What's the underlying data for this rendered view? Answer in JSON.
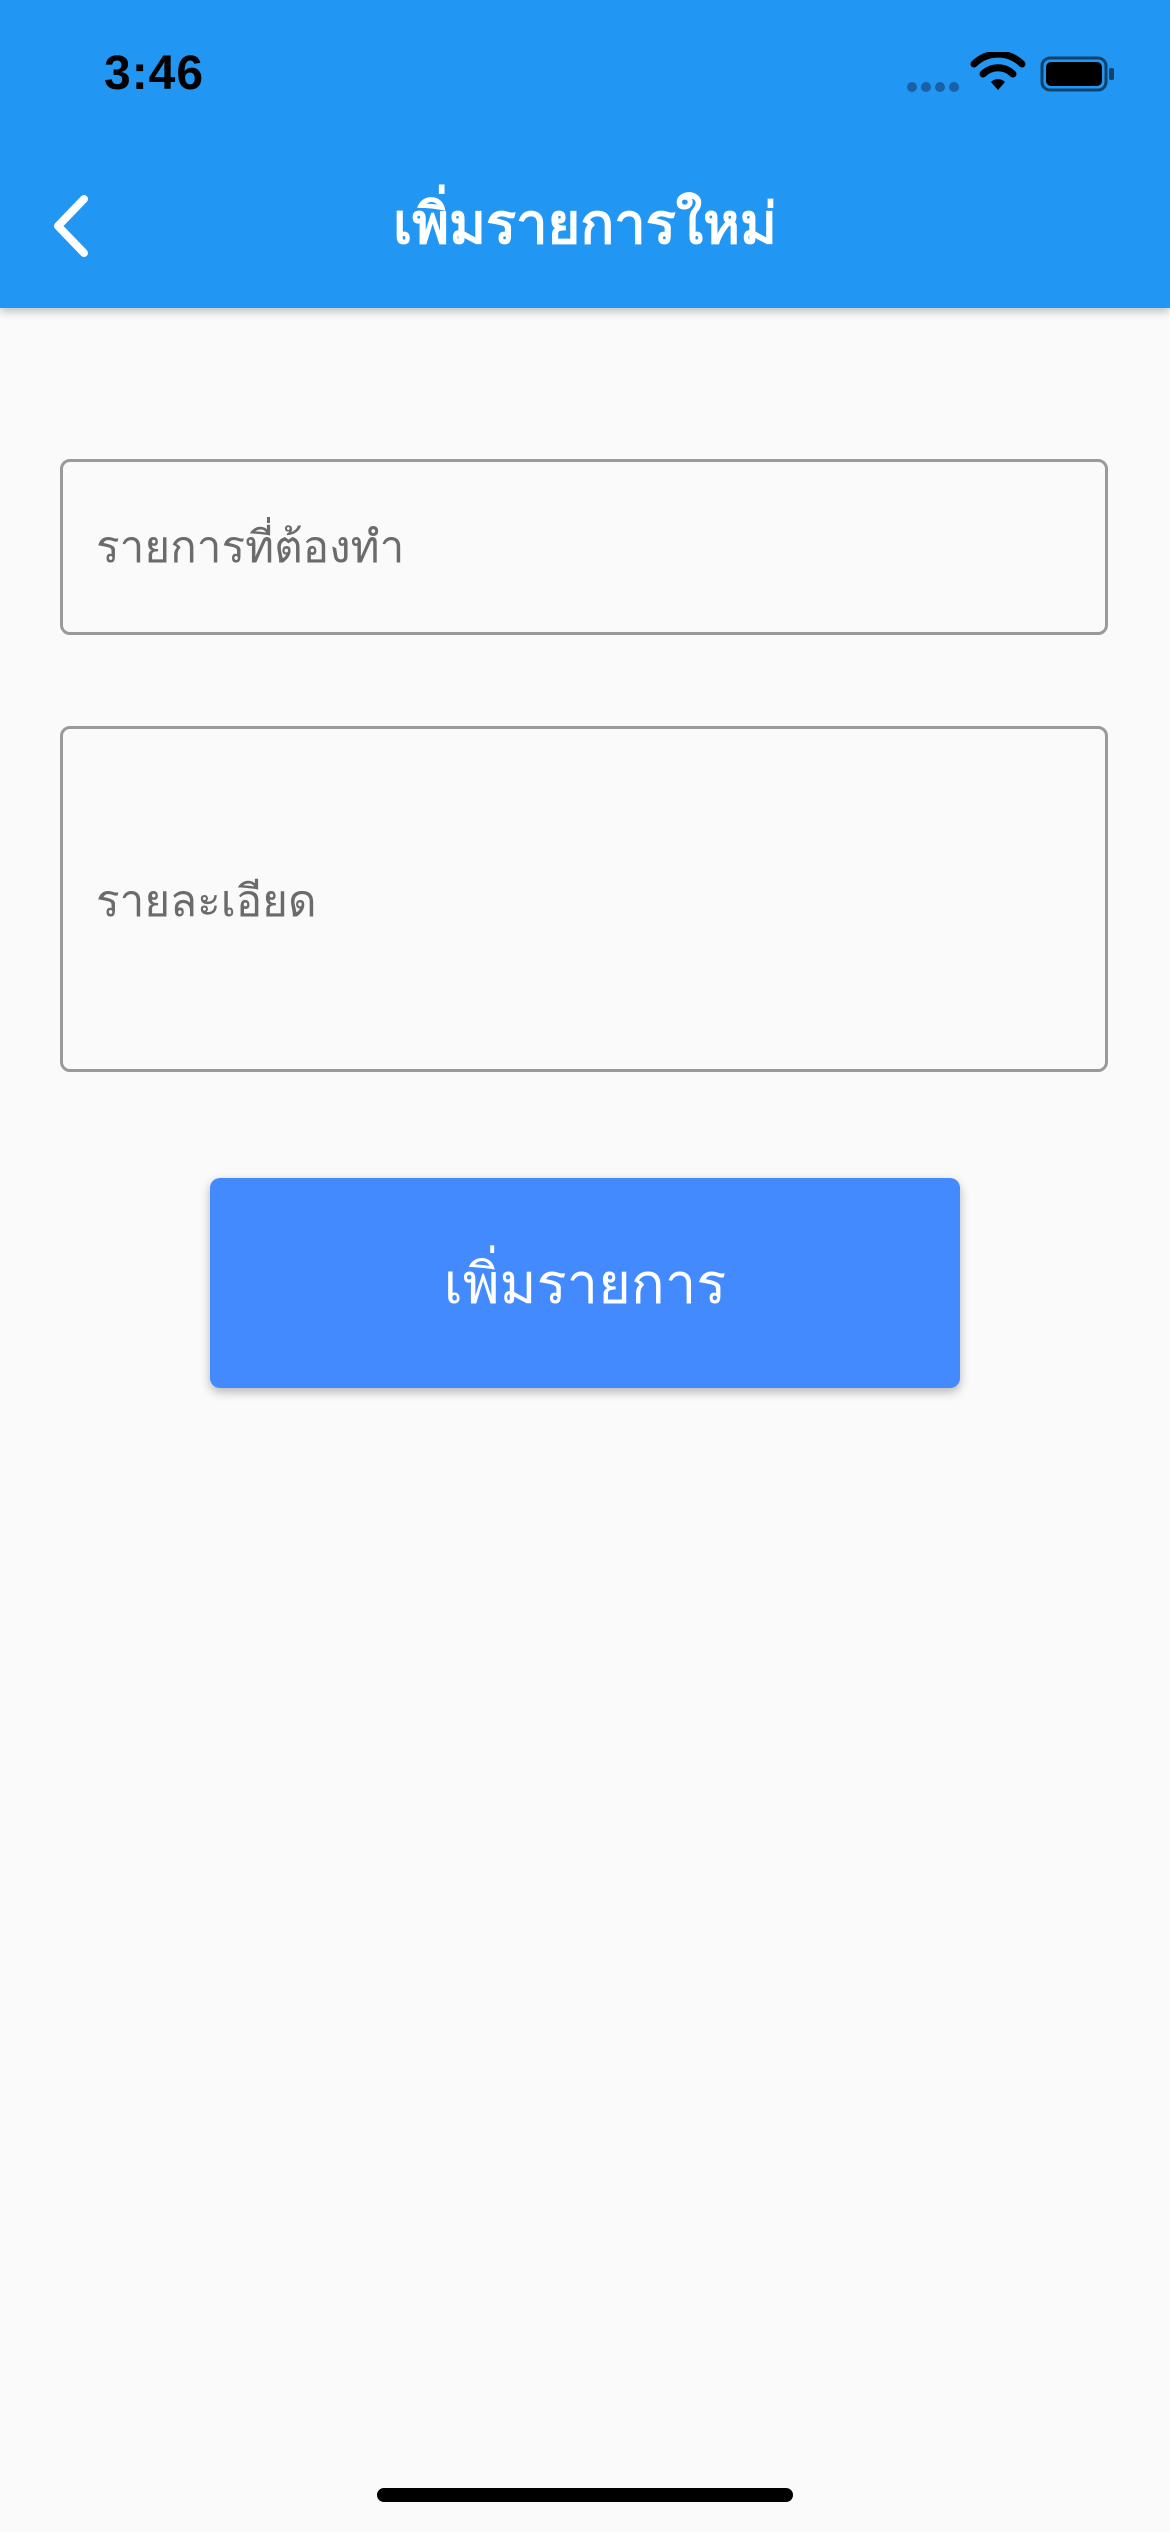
{
  "status_bar": {
    "time": "3:46"
  },
  "app_bar": {
    "title": "เพิ่มรายการใหม่",
    "back_icon": "chevron-left-icon"
  },
  "form": {
    "title_field": {
      "placeholder": "รายการที่ต้องทำ",
      "value": ""
    },
    "detail_field": {
      "placeholder": "รายละเอียด",
      "value": ""
    },
    "submit_label": "เพิ่มรายการ"
  },
  "colors": {
    "app_bar": "#2196f3",
    "button": "#448aff",
    "background": "#fafafa",
    "field_border": "#9a9a9a"
  }
}
